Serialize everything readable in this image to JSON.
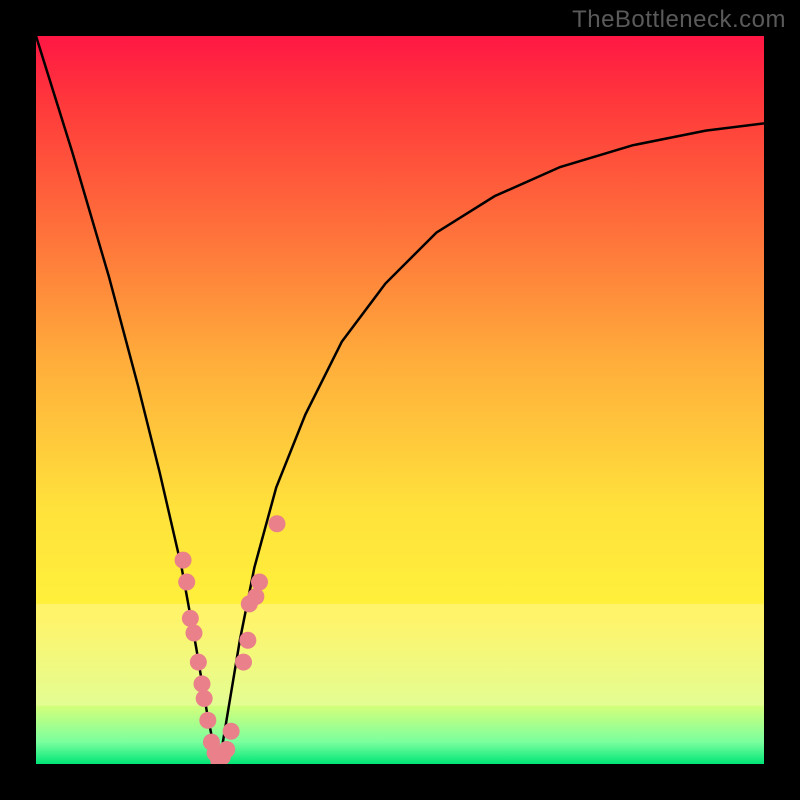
{
  "attribution": "TheBottleneck.com",
  "chart_data": {
    "type": "line",
    "title": "",
    "xlabel": "",
    "ylabel": "",
    "x_range": [
      0,
      100
    ],
    "y_range": [
      0,
      100
    ],
    "series": [
      {
        "name": "bottleneck-curve",
        "x": [
          0,
          5,
          10,
          14,
          17,
          20,
          22,
          23.5,
          24.5,
          25,
          25.5,
          26,
          27,
          28,
          30,
          33,
          37,
          42,
          48,
          55,
          63,
          72,
          82,
          92,
          100
        ],
        "y": [
          100,
          84,
          67,
          52,
          40,
          27,
          16,
          7,
          2,
          0,
          2,
          5,
          11,
          17,
          27,
          38,
          48,
          58,
          66,
          73,
          78,
          82,
          85,
          87,
          88
        ]
      }
    ],
    "markers": {
      "name": "sample-points",
      "color": "#e9808a",
      "points": [
        {
          "x": 20.2,
          "y": 28
        },
        {
          "x": 20.7,
          "y": 25
        },
        {
          "x": 21.2,
          "y": 20
        },
        {
          "x": 21.7,
          "y": 18
        },
        {
          "x": 22.3,
          "y": 14
        },
        {
          "x": 22.8,
          "y": 11
        },
        {
          "x": 23.1,
          "y": 9
        },
        {
          "x": 23.6,
          "y": 6
        },
        {
          "x": 24.1,
          "y": 3
        },
        {
          "x": 24.6,
          "y": 1.5
        },
        {
          "x": 25.1,
          "y": 0.5
        },
        {
          "x": 25.6,
          "y": 1
        },
        {
          "x": 26.2,
          "y": 2
        },
        {
          "x": 26.8,
          "y": 4.5
        },
        {
          "x": 28.5,
          "y": 14
        },
        {
          "x": 29.1,
          "y": 17
        },
        {
          "x": 29.3,
          "y": 22
        },
        {
          "x": 30.2,
          "y": 23
        },
        {
          "x": 30.7,
          "y": 25
        },
        {
          "x": 33.1,
          "y": 33
        }
      ]
    },
    "gradient": {
      "stops": [
        {
          "offset": 0,
          "color": "#ff1744"
        },
        {
          "offset": 10,
          "color": "#ff3b3b"
        },
        {
          "offset": 25,
          "color": "#ff6b3b"
        },
        {
          "offset": 45,
          "color": "#ffae3b"
        },
        {
          "offset": 65,
          "color": "#ffe23b"
        },
        {
          "offset": 80,
          "color": "#fff23b"
        },
        {
          "offset": 92,
          "color": "#d4ff7a"
        },
        {
          "offset": 97,
          "color": "#7aff9e"
        },
        {
          "offset": 100,
          "color": "#00e676"
        }
      ]
    },
    "highlight_band": {
      "y_start": 78,
      "y_end": 92,
      "color": "#fff9c4",
      "opacity": 0.35
    }
  }
}
